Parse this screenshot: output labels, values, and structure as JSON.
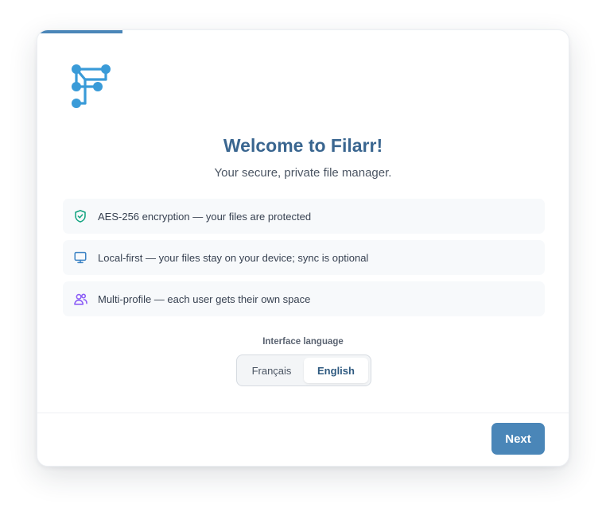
{
  "progress": {
    "fraction": 0.16
  },
  "logo": {
    "icon": "filarr-logo-icon",
    "color": "#3a9bd8"
  },
  "header": {
    "title": "Welcome to Filarr!",
    "subtitle": "Your secure, private file manager."
  },
  "features": [
    {
      "icon": "shield-check-icon",
      "color": "#10a37f",
      "text": "AES-256 encryption — your files are protected"
    },
    {
      "icon": "monitor-icon",
      "color": "#3b82c4",
      "text": "Local-first — your files stay on your device; sync is optional"
    },
    {
      "icon": "users-icon",
      "color": "#8b5cf6",
      "text": "Multi-profile — each user gets their own space"
    }
  ],
  "language": {
    "label": "Interface language",
    "options": [
      "Français",
      "English"
    ],
    "selected": "English"
  },
  "footer": {
    "next_label": "Next"
  },
  "colors": {
    "accent": "#4a86b8",
    "title": "#3a6690"
  }
}
